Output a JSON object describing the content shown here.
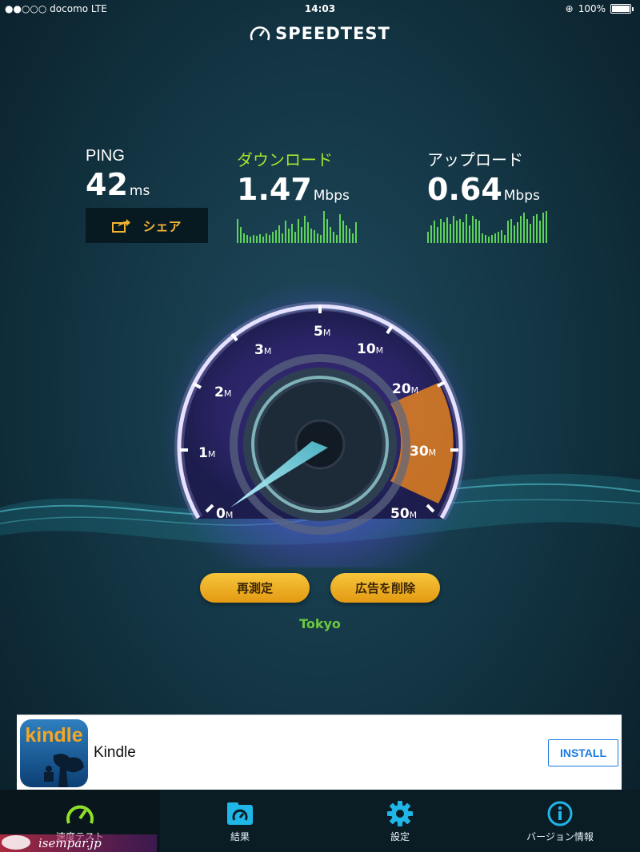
{
  "status_bar": {
    "carrier": "●●○○○ docomo  LTE",
    "time": "14:03",
    "battery": "100%"
  },
  "app": {
    "title": "SPEEDTEST"
  },
  "metrics": {
    "ping": {
      "label": "PING",
      "value": "42",
      "unit": "ms"
    },
    "download": {
      "label": "ダウンロード",
      "value": "1.47",
      "unit": "Mbps"
    },
    "upload": {
      "label": "アップロード",
      "value": "0.64",
      "unit": "Mbps"
    }
  },
  "share_button": {
    "label": "シェア"
  },
  "gauge": {
    "scale_labels": [
      "0",
      "1",
      "2",
      "3",
      "5",
      "10",
      "20",
      "30",
      "50"
    ],
    "unit_suffix": "M"
  },
  "buttons": {
    "retest": "再測定",
    "remove_ads": "広告を削除"
  },
  "server": "Tokyo",
  "ad": {
    "name": "Kindle",
    "icon_text": "kindle",
    "cta": "INSTALL"
  },
  "tabs": [
    {
      "label": "速度テスト",
      "icon": "speedometer-icon"
    },
    {
      "label": "結果",
      "icon": "results-folder-icon"
    },
    {
      "label": "設定",
      "icon": "gear-icon"
    },
    {
      "label": "バージョン情報",
      "icon": "info-icon"
    }
  ],
  "watermark": "isempar.jp",
  "colors": {
    "accent_green": "#a6e22e",
    "button_gold": "#f2b42c",
    "tab_icon": "#1fb6e8",
    "active_tab_icon": "#8fe02a",
    "server_green": "#6cc93c"
  }
}
